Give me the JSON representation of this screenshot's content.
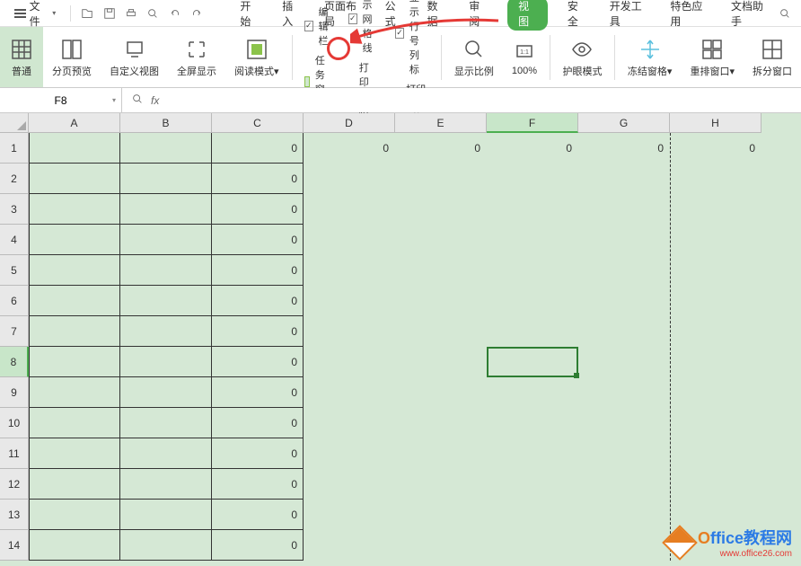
{
  "topbar": {
    "file_label": "文件",
    "menu_tabs": [
      "开始",
      "插入",
      "页面布局",
      "公式",
      "数据",
      "审阅",
      "视图",
      "安全",
      "开发工具",
      "特色应用",
      "文档助手"
    ],
    "active_tab_index": 6
  },
  "ribbon": {
    "groups": [
      {
        "label": "普通",
        "icon": "grid"
      },
      {
        "label": "分页预览",
        "icon": "page-break"
      },
      {
        "label": "自定义视图",
        "icon": "custom-view"
      },
      {
        "label": "全屏显示",
        "icon": "fullscreen"
      },
      {
        "label": "阅读模式",
        "icon": "reading",
        "dropdown": true
      }
    ],
    "checkboxes_col1": [
      {
        "label": "编辑栏",
        "checked": true
      },
      {
        "label": "任务窗格",
        "checked": false,
        "green": true
      }
    ],
    "checkboxes_col2": [
      {
        "label": "显示网格线",
        "checked": true
      },
      {
        "label": "打印网格线",
        "checked": false
      }
    ],
    "checkboxes_col3": [
      {
        "label": "显示行号列标",
        "checked": true
      },
      {
        "label": "打印行号列标",
        "checked": false
      }
    ],
    "zoom_group": {
      "label": "显示比例",
      "icon": "zoom"
    },
    "zoom_100": "100%",
    "eye_care": "护眼模式",
    "freeze": "冻结窗格",
    "rearrange": "重排窗口",
    "split": "拆分窗口"
  },
  "formula_bar": {
    "cell_ref": "F8",
    "formula": ""
  },
  "sheet": {
    "columns": [
      "A",
      "B",
      "C",
      "D",
      "E",
      "F",
      "G",
      "H"
    ],
    "active_col": "F",
    "row_count": 14,
    "active_row": 8,
    "row1_values": [
      "",
      "",
      "0",
      "0",
      "0",
      "0",
      "0",
      "0"
    ],
    "colC_values": [
      "0",
      "0",
      "0",
      "0",
      "0",
      "0",
      "0",
      "0",
      "0",
      "0",
      "0",
      "0",
      "0",
      "0"
    ],
    "selected_cell": "F8"
  },
  "watermark": {
    "brand_o": "O",
    "brand_rest": "ffice教程网",
    "url": "www.office26.com"
  }
}
